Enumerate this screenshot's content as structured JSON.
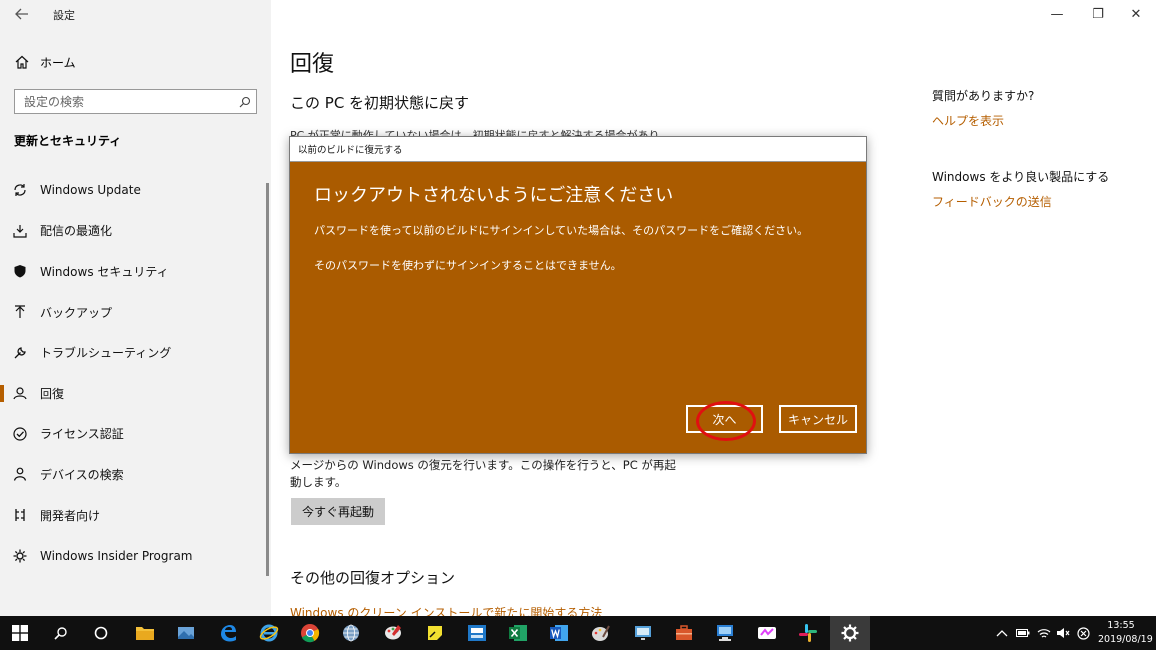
{
  "window": {
    "title": "設定",
    "controls": {
      "minimize": "—",
      "restore": "❐",
      "close": "✕"
    }
  },
  "sidebar": {
    "home_label": "ホーム",
    "search_placeholder": "設定の検索",
    "section_heading": "更新とセキュリティ",
    "items": [
      {
        "label": "Windows Update",
        "icon": "sync-icon"
      },
      {
        "label": "配信の最適化",
        "icon": "delivery-icon"
      },
      {
        "label": "Windows セキュリティ",
        "icon": "shield-icon"
      },
      {
        "label": "バックアップ",
        "icon": "backup-arrow-icon"
      },
      {
        "label": "トラブルシューティング",
        "icon": "wrench-icon"
      },
      {
        "label": "回復",
        "icon": "recovery-icon",
        "active": true
      },
      {
        "label": "ライセンス認証",
        "icon": "check-circle-icon"
      },
      {
        "label": "デバイスの検索",
        "icon": "person-icon"
      },
      {
        "label": "開発者向け",
        "icon": "developer-icon"
      },
      {
        "label": "Windows Insider Program",
        "icon": "insider-icon"
      }
    ]
  },
  "main": {
    "page_title": "回復",
    "reset_heading": "この PC を初期状態に戻す",
    "reset_text_partial": "PC が正常に動作していない場合は、初期状態に戻すと解決する場合があり",
    "advanced_text": "メージからの Windows の復元を行います。この操作を行うと、PC が再起動します。",
    "restart_button": "今すぐ再起動",
    "other_heading": "その他の回復オプション",
    "other_link_partial": "Windows のクリーン インストールで新たに開始する方法"
  },
  "right": {
    "question_heading": "質問がありますか?",
    "help_link": "ヘルプを表示",
    "improve_heading": "Windows をより良い製品にする",
    "feedback_link": "フィードバックの送信"
  },
  "dialog": {
    "title": "以前のビルドに復元する",
    "heading": "ロックアウトされないようにご注意ください",
    "line1": "パスワードを使って以前のビルドにサインインしていた場合は、そのパスワードをご確認ください。",
    "line2": "そのパスワードを使わずにサインインすることはできません。",
    "next_button": "次へ",
    "cancel_button": "キャンセル",
    "bg_color": "#aa5b00"
  },
  "taskbar": {
    "clock_time": "13:55",
    "clock_date": "2019/08/19",
    "accent": "#b55e00"
  }
}
